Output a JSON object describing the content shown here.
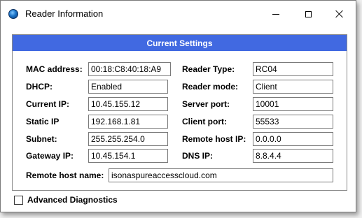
{
  "window": {
    "title": "Reader Information",
    "app_icon": "globe-icon"
  },
  "panel": {
    "header": "Current Settings",
    "left": [
      {
        "label": "MAC address:",
        "value": "00:18:C8:40:18:A9"
      },
      {
        "label": "DHCP:",
        "value": "Enabled"
      },
      {
        "label": "Current IP:",
        "value": "10.45.155.12"
      },
      {
        "label": "Static IP",
        "value": "192.168.1.81"
      },
      {
        "label": "Subnet:",
        "value": "255.255.254.0"
      },
      {
        "label": "Gateway IP:",
        "value": "10.45.154.1"
      }
    ],
    "right": [
      {
        "label": "Reader Type:",
        "value": "RC04"
      },
      {
        "label": "Reader mode:",
        "value": "Client"
      },
      {
        "label": "Server port:",
        "value": "10001"
      },
      {
        "label": "Client port:",
        "value": "55533"
      },
      {
        "label": "Remote host IP:",
        "value": "0.0.0.0"
      },
      {
        "label": "DNS IP:",
        "value": "8.8.4.4"
      }
    ],
    "remote_host_name": {
      "label": "Remote host name:",
      "value": "isonaspureaccesscloud.com"
    }
  },
  "advanced_diagnostics": {
    "label": "Advanced Diagnostics",
    "checked": false
  },
  "colors": {
    "header_bg": "#4169e1",
    "header_text": "#ffffff"
  }
}
